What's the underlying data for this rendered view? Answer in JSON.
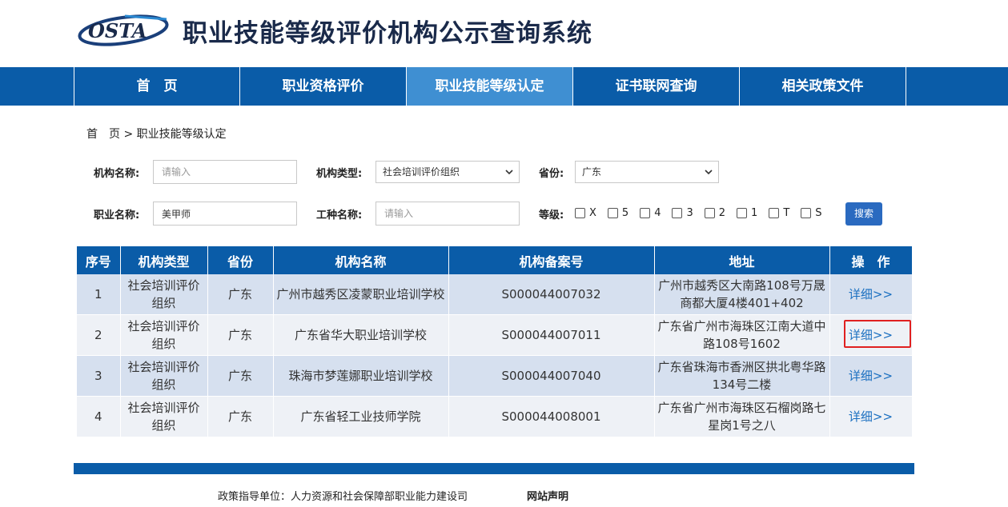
{
  "header": {
    "logo_text": "OSTA",
    "title": "职业技能等级评价机构公示查询系统"
  },
  "nav": [
    {
      "label": "首　页"
    },
    {
      "label": "职业资格评价"
    },
    {
      "label": "职业技能等级认定"
    },
    {
      "label": "证书联网查询"
    },
    {
      "label": "相关政策文件"
    }
  ],
  "breadcrumb": "首　页 > 职业技能等级认定",
  "filters": {
    "org_name_label": "机构名称:",
    "org_name_placeholder": "请输入",
    "org_type_label": "机构类型:",
    "org_type_value": "社会培训评价组织",
    "province_label": "省份:",
    "province_value": "广东",
    "occupation_label": "职业名称:",
    "occupation_value": "美甲师",
    "job_type_label": "工种名称:",
    "job_type_placeholder": "请输入",
    "level_label": "等级:",
    "levels": [
      "X",
      "5",
      "4",
      "3",
      "2",
      "1",
      "T",
      "S"
    ],
    "search_label": "搜索"
  },
  "table": {
    "headers": [
      "序号",
      "机构类型",
      "省份",
      "机构名称",
      "机构备案号",
      "地址",
      "操　作"
    ],
    "rows": [
      {
        "no": "1",
        "type": "社会培训评价组织",
        "province": "广东",
        "name": "广州市越秀区凌蒙职业培训学校",
        "code": "S000044007032",
        "address": "广州市越秀区大南路108号万晟商都大厦4楼401+402",
        "action": "详细>>"
      },
      {
        "no": "2",
        "type": "社会培训评价组织",
        "province": "广东",
        "name": "广东省华大职业培训学校",
        "code": "S000044007011",
        "address": "广东省广州市海珠区江南大道中路108号1602",
        "action": "详细>>"
      },
      {
        "no": "3",
        "type": "社会培训评价组织",
        "province": "广东",
        "name": "珠海市梦莲娜职业培训学校",
        "code": "S000044007040",
        "address": "广东省珠海市香洲区拱北粤华路134号二楼",
        "action": "详细>>"
      },
      {
        "no": "4",
        "type": "社会培训评价组织",
        "province": "广东",
        "name": "广东省轻工业技师学院",
        "code": "S000044008001",
        "address": "广东省广州市海珠区石榴岗路七星岗1号之八",
        "action": "详细>>"
      }
    ]
  },
  "footer": {
    "guide": "政策指导单位：人力资源和社会保障部职业能力建设司",
    "statement": "网站声明"
  },
  "colors": {
    "primary": "#0a5ca8",
    "active_tab": "#3f8fd2",
    "highlight": "#e02020",
    "link": "#1a6fc0"
  }
}
